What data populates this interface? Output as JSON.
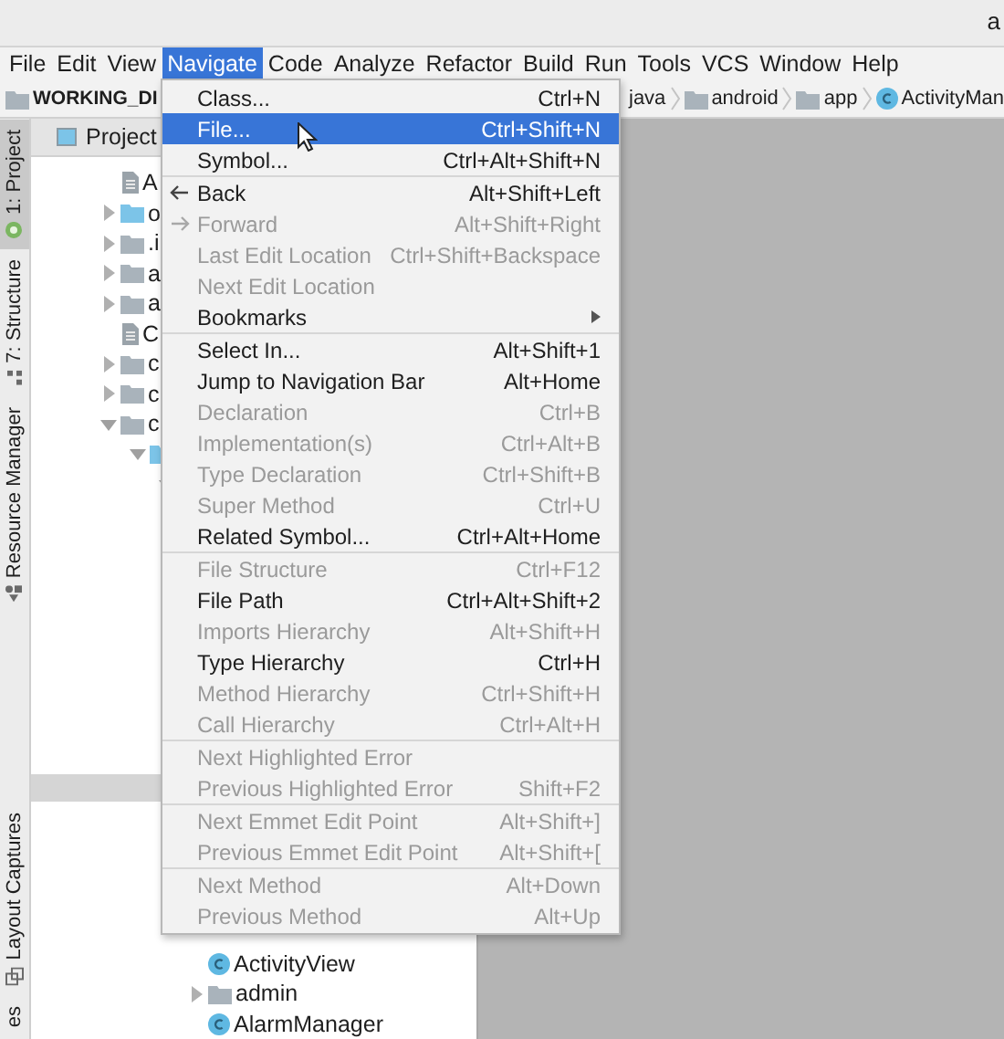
{
  "window": {
    "title": "a"
  },
  "menu_bar": [
    {
      "label": "File",
      "selected": false
    },
    {
      "label": "Edit",
      "selected": false
    },
    {
      "label": "View",
      "selected": false
    },
    {
      "label": "Navigate",
      "selected": true
    },
    {
      "label": "Code",
      "selected": false
    },
    {
      "label": "Analyze",
      "selected": false
    },
    {
      "label": "Refactor",
      "selected": false
    },
    {
      "label": "Build",
      "selected": false
    },
    {
      "label": "Run",
      "selected": false
    },
    {
      "label": "Tools",
      "selected": false
    },
    {
      "label": "VCS",
      "selected": false
    },
    {
      "label": "Window",
      "selected": false
    },
    {
      "label": "Help",
      "selected": false
    }
  ],
  "breadcrumbs_left": [
    {
      "label": "WORKING_DI",
      "kind": "project"
    }
  ],
  "breadcrumbs_right": [
    {
      "label": "java",
      "kind": "plain"
    },
    {
      "label": "android",
      "kind": "folder"
    },
    {
      "label": "app",
      "kind": "folder"
    },
    {
      "label": "ActivityMan",
      "kind": "class"
    }
  ],
  "tool_strip_top": [
    {
      "label": "1: Project",
      "selected": true,
      "kind": "android"
    },
    {
      "label": "7: Structure",
      "selected": false,
      "kind": "structure"
    },
    {
      "label": "Resource Manager",
      "selected": false,
      "kind": "resources"
    }
  ],
  "tool_strip_bottom": [
    {
      "label": "Layout Captures",
      "selected": false,
      "kind": "captures"
    },
    {
      "label": "es",
      "selected": false
    }
  ],
  "project_panel": {
    "title": "Project",
    "tree": [
      {
        "label": "A",
        "kind": "file",
        "selected": false
      },
      {
        "label": "o",
        "kind": "source-folder",
        "expanded": false,
        "selected": false
      },
      {
        "label": ".i",
        "kind": "folder",
        "expanded": false,
        "selected": false
      },
      {
        "label": "a",
        "kind": "folder",
        "expanded": false,
        "selected": false
      },
      {
        "label": "a",
        "kind": "folder",
        "expanded": false,
        "selected": false
      },
      {
        "label": "C",
        "kind": "file",
        "selected": false
      },
      {
        "label": "c",
        "kind": "folder",
        "expanded": false,
        "selected": false
      },
      {
        "label": "c",
        "kind": "folder",
        "expanded": false,
        "selected": false
      },
      {
        "label": "c",
        "kind": "folder",
        "expanded": true,
        "selected": false,
        "children": [
          {
            "kind": "source-folder",
            "expanded": true,
            "selected": false,
            "children": [
              {
                "expanded": true,
                "selected": false,
                "children": [
                  {
                    "selected": true,
                    "kind": "blank"
                  },
                  {
                    "label": "ActivityView",
                    "kind": "class",
                    "selected": false
                  },
                  {
                    "label": "admin",
                    "kind": "folder",
                    "expanded": false,
                    "selected": false
                  },
                  {
                    "label": "AlarmManager",
                    "kind": "class",
                    "selected": false
                  }
                ]
              }
            ]
          }
        ]
      }
    ]
  },
  "menu": {
    "sections": [
      [
        {
          "label": "Class...",
          "shortcut": "Ctrl+N",
          "disabled": false,
          "selected": false
        },
        {
          "label": "File...",
          "shortcut": "Ctrl+Shift+N",
          "disabled": false,
          "selected": true
        },
        {
          "label": "Symbol...",
          "shortcut": "Ctrl+Alt+Shift+N",
          "disabled": false,
          "selected": false
        }
      ],
      [
        {
          "label": "Back",
          "shortcut": "Alt+Shift+Left",
          "disabled": false,
          "selected": false,
          "kind": "back"
        },
        {
          "label": "Forward",
          "shortcut": "Alt+Shift+Right",
          "disabled": true,
          "selected": false,
          "kind": "forward"
        },
        {
          "label": "Last Edit Location",
          "shortcut": "Ctrl+Shift+Backspace",
          "disabled": true,
          "selected": false
        },
        {
          "label": "Next Edit Location",
          "disabled": true,
          "selected": false
        },
        {
          "label": "Bookmarks",
          "disabled": false,
          "selected": false,
          "submenu": true
        }
      ],
      [
        {
          "label": "Select In...",
          "shortcut": "Alt+Shift+1",
          "disabled": false,
          "selected": false
        },
        {
          "label": "Jump to Navigation Bar",
          "shortcut": "Alt+Home",
          "disabled": false,
          "selected": false
        },
        {
          "label": "Declaration",
          "shortcut": "Ctrl+B",
          "disabled": true,
          "selected": false
        },
        {
          "label": "Implementation(s)",
          "shortcut": "Ctrl+Alt+B",
          "disabled": true,
          "selected": false
        },
        {
          "label": "Type Declaration",
          "shortcut": "Ctrl+Shift+B",
          "disabled": true,
          "selected": false
        },
        {
          "label": "Super Method",
          "shortcut": "Ctrl+U",
          "disabled": true,
          "selected": false
        },
        {
          "label": "Related Symbol...",
          "shortcut": "Ctrl+Alt+Home",
          "disabled": false,
          "selected": false
        }
      ],
      [
        {
          "label": "File Structure",
          "shortcut": "Ctrl+F12",
          "disabled": true,
          "selected": false
        },
        {
          "label": "File Path",
          "shortcut": "Ctrl+Alt+Shift+2",
          "disabled": false,
          "selected": false
        },
        {
          "label": "Imports Hierarchy",
          "shortcut": "Alt+Shift+H",
          "disabled": true,
          "selected": false
        },
        {
          "label": "Type Hierarchy",
          "shortcut": "Ctrl+H",
          "disabled": false,
          "selected": false
        },
        {
          "label": "Method Hierarchy",
          "shortcut": "Ctrl+Shift+H",
          "disabled": true,
          "selected": false
        },
        {
          "label": "Call Hierarchy",
          "shortcut": "Ctrl+Alt+H",
          "disabled": true,
          "selected": false
        }
      ],
      [
        {
          "label": "Next Highlighted Error",
          "disabled": true,
          "selected": false
        },
        {
          "label": "Previous Highlighted Error",
          "shortcut": "Shift+F2",
          "disabled": true,
          "selected": false
        }
      ],
      [
        {
          "label": "Next Emmet Edit Point",
          "shortcut": "Alt+Shift+]",
          "disabled": true,
          "selected": false
        },
        {
          "label": "Previous Emmet Edit Point",
          "shortcut": "Alt+Shift+[",
          "disabled": true,
          "selected": false
        }
      ],
      [
        {
          "label": "Next Method",
          "shortcut": "Alt+Down",
          "disabled": true,
          "selected": false
        },
        {
          "label": "Previous Method",
          "shortcut": "Alt+Up",
          "disabled": true,
          "selected": false
        }
      ]
    ]
  }
}
